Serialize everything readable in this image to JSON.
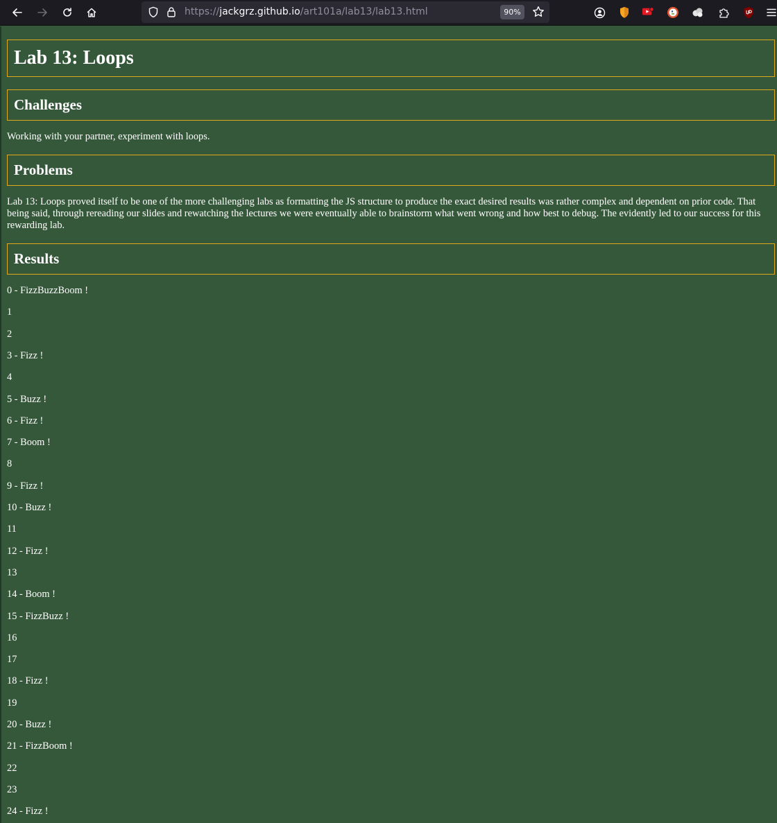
{
  "browser": {
    "url_scheme": "https://",
    "url_host": "jackgrz.github.io",
    "url_path": "/art101a/lab13/lab13.html",
    "zoom": "90%"
  },
  "page": {
    "title": "Lab 13: Loops",
    "sections": {
      "challenges": {
        "heading": "Challenges",
        "text": "Working with your partner, experiment with loops."
      },
      "problems": {
        "heading": "Problems",
        "text": "Lab 13: Loops proved itself to be one of the more challenging labs as formatting the JS structure to produce the exact desired results was rather complex and dependent on prior code. That being said, through rereading our slides and rewatching the lectures we were eventually able to brainstorm what went wrong and how best to debug. The evidently led to our success for this rewarding lab."
      },
      "results": {
        "heading": "Results",
        "lines": [
          "0 - FizzBuzzBoom !",
          "1",
          "2",
          "3 - Fizz !",
          "4",
          "5 - Buzz !",
          "6 - Fizz !",
          "7 - Boom !",
          "8",
          "9 - Fizz !",
          "10 - Buzz !",
          "11",
          "12 - Fizz !",
          "13",
          "14 - Boom !",
          "15 - FizzBuzz !",
          "16",
          "17",
          "18 - Fizz !",
          "19",
          "20 - Buzz !",
          "21 - FizzBoom !",
          "22",
          "23",
          "24 - Fizz !"
        ]
      }
    }
  },
  "colors": {
    "page_background": "#35573a",
    "heading_border": "#e0a81c",
    "text": "#ffffff"
  },
  "icons": {
    "back": "arrow-left-icon",
    "forward": "arrow-right-icon",
    "reload": "reload-icon",
    "home": "home-icon",
    "tracking": "shield-icon",
    "lock": "lock-icon",
    "bookmark": "star-icon",
    "account": "account-icon",
    "menu": "hamburger-menu-icon"
  }
}
